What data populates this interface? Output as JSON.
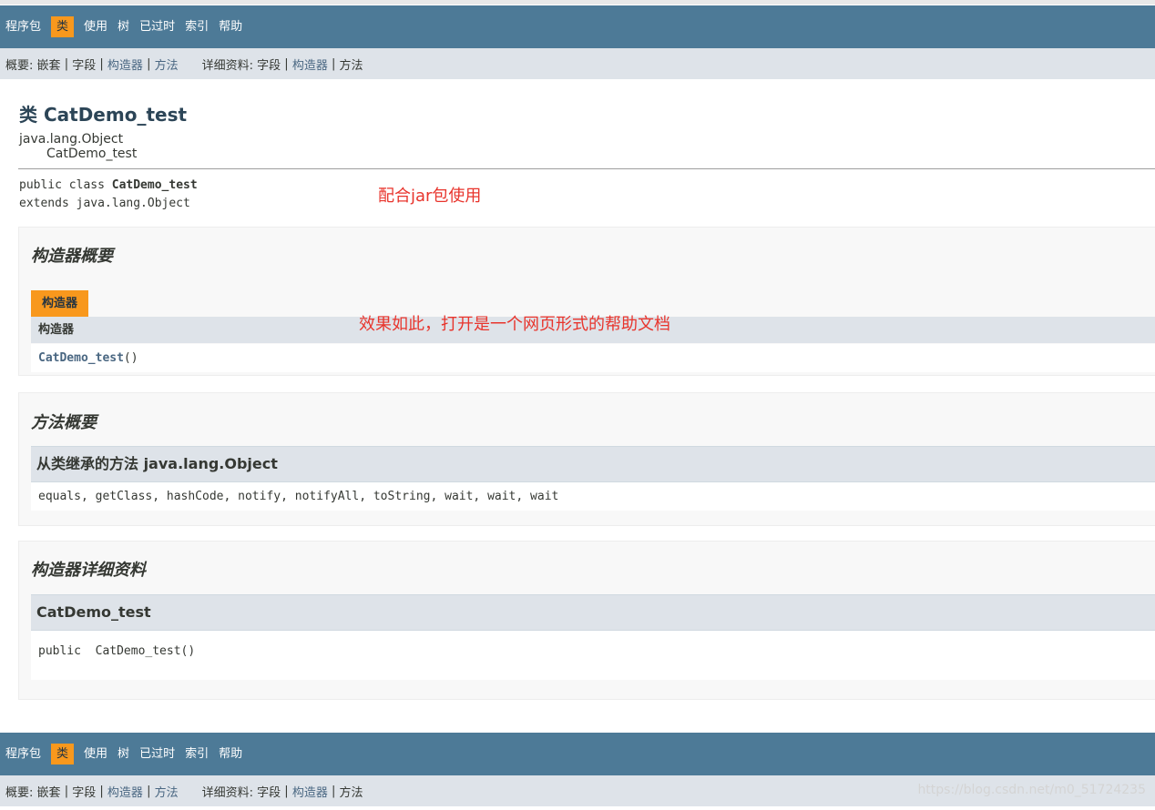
{
  "top_nav": {
    "items": [
      {
        "label": "程序包",
        "active": false
      },
      {
        "label": "类",
        "active": true
      },
      {
        "label": "使用",
        "active": false
      },
      {
        "label": "树",
        "active": false
      },
      {
        "label": "已过时",
        "active": false
      },
      {
        "label": "索引",
        "active": false
      },
      {
        "label": "帮助",
        "active": false
      }
    ]
  },
  "sub_nav": {
    "summary_label": "概要:",
    "summary_nested": "嵌套",
    "summary_field": "字段",
    "summary_constr": "构造器",
    "summary_method": "方法",
    "detail_label": "详细资料:",
    "detail_field": "字段",
    "detail_constr": "构造器",
    "detail_method": "方法",
    "separator": "|"
  },
  "header": {
    "title": "类 CatDemo_test",
    "inheritance_root": "java.lang.Object",
    "inheritance_child": "CatDemo_test"
  },
  "declaration": {
    "line1_prefix": "public class ",
    "line1_name": "CatDemo_test",
    "line2": "extends java.lang.Object"
  },
  "annotations": {
    "note1": "配合jar包使用",
    "note2": "效果如此，打开是一个网页形式的帮助文档"
  },
  "constructor_summary": {
    "heading": "构造器概要",
    "caption": "构造器",
    "column_header": "构造器",
    "row_name": "CatDemo_test",
    "row_parens": "()"
  },
  "method_summary": {
    "heading": "方法概要",
    "inherited_header": "从类继承的方法 java.lang.Object",
    "inherited_methods": "equals, getClass, hashCode, notify, notifyAll, toString, wait, wait, wait"
  },
  "constructor_detail": {
    "heading": "构造器详细资料",
    "name": "CatDemo_test",
    "signature": "public  CatDemo_test()"
  },
  "watermark": "https://blog.csdn.net/m0_51724235",
  "colors": {
    "nav_bg": "#4d7a97",
    "nav_active": "#f8981d",
    "subnav_bg": "#dee3e9",
    "link": "#4a6782",
    "annotation": "#e8342c"
  }
}
